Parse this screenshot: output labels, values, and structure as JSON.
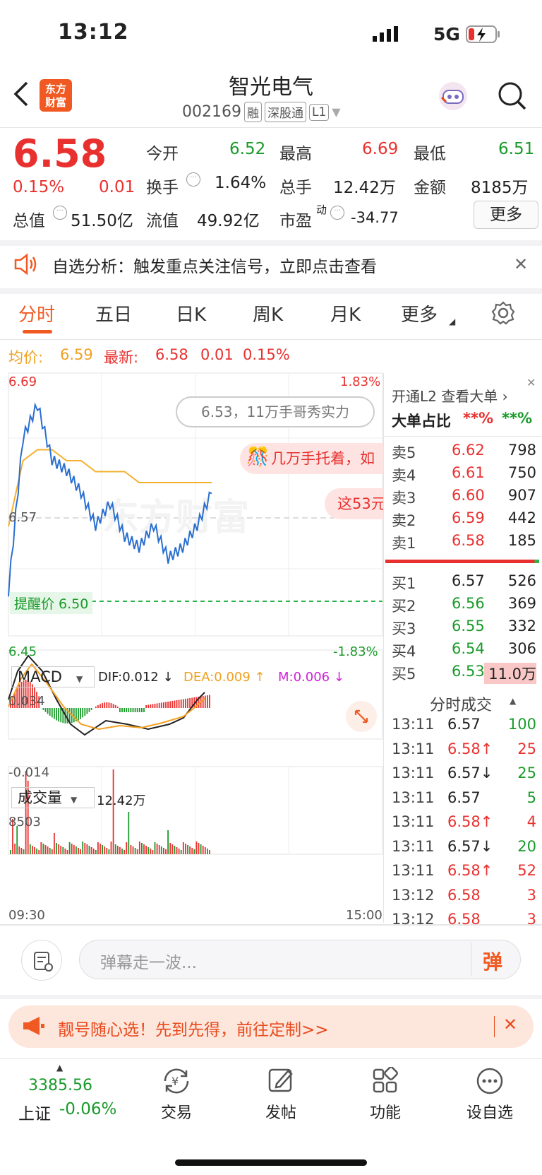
{
  "status": {
    "time": "13:12",
    "network": "5G"
  },
  "header": {
    "title": "智光电气",
    "code": "002169",
    "tags": [
      "融",
      "深股通",
      "L1"
    ],
    "logo": "东方财富"
  },
  "quote": {
    "price": "6.58",
    "pct": "0.15%",
    "chg": "0.01",
    "open_label": "今开",
    "open": "6.52",
    "high_label": "最高",
    "high": "6.69",
    "low_label": "最低",
    "low": "6.51",
    "turnover_label": "换手",
    "turnover": "1.64%",
    "vol_label": "总手",
    "vol": "12.42万",
    "amt_label": "金额",
    "amt": "8185万",
    "mcap_label": "总值",
    "mcap": "51.50亿",
    "float_label": "流值",
    "float": "49.92亿",
    "pe_label": "市盈",
    "pe_sup": "动",
    "pe": "-34.77",
    "more": "更多"
  },
  "notice": "自选分析：触发重点关注信号，立即点击查看",
  "tabs": [
    "分时",
    "五日",
    "日K",
    "周K",
    "月K",
    "更多"
  ],
  "info": {
    "avg_label": "均价:",
    "avg": "6.59",
    "last_label": "最新:",
    "last": "6.58",
    "chg": "0.01",
    "pct": "0.15%"
  },
  "chart": {
    "ymax": "6.69",
    "ymin": "6.45",
    "ymid": "6.57",
    "pmax": "1.83%",
    "pmin": "-1.83%",
    "alert": "提醒价 6.50",
    "watermark": "东方财富",
    "bubble1": "6.53，11万手哥秀实力",
    "bubble2": "几万手托着，如",
    "bubble3": "这53元",
    "macd_label": "MACD",
    "dif": "DIF:0.012 ↓",
    "dea": "DEA:0.009 ↑",
    "m": "M:0.006 ↓",
    "macd_top": "0.034",
    "macd_bot": "-0.014",
    "vol_label": "成交量",
    "vol_total": "12.42万",
    "vol_max": "8503",
    "t_start": "09:30",
    "t_end": "15:00"
  },
  "chart_data": {
    "type": "line",
    "x_range": [
      "09:30",
      "15:00"
    ],
    "ylim": [
      6.45,
      6.69
    ],
    "series": [
      {
        "name": "价格",
        "values": [
          6.49,
          6.63,
          6.66,
          6.61,
          6.6,
          6.58,
          6.55,
          6.57,
          6.54,
          6.53,
          6.55,
          6.52,
          6.53,
          6.55,
          6.58
        ]
      },
      {
        "name": "均价",
        "values": [
          6.55,
          6.61,
          6.62,
          6.62,
          6.61,
          6.61,
          6.6,
          6.6,
          6.6,
          6.59,
          6.59,
          6.59,
          6.59,
          6.59,
          6.59
        ]
      }
    ]
  },
  "l2": {
    "title": "开通L2 查看大单 ›",
    "ratio_label": "大单占比",
    "ratio_red": "**%",
    "ratio_green": "**%"
  },
  "asks": [
    {
      "l": "卖5",
      "p": "6.62",
      "v": "798"
    },
    {
      "l": "卖4",
      "p": "6.61",
      "v": "750"
    },
    {
      "l": "卖3",
      "p": "6.60",
      "v": "907"
    },
    {
      "l": "卖2",
      "p": "6.59",
      "v": "442"
    },
    {
      "l": "卖1",
      "p": "6.58",
      "v": "185"
    }
  ],
  "bids": [
    {
      "l": "买1",
      "p": "6.57",
      "v": "526"
    },
    {
      "l": "买2",
      "p": "6.56",
      "v": "369"
    },
    {
      "l": "买3",
      "p": "6.55",
      "v": "332"
    },
    {
      "l": "买4",
      "p": "6.54",
      "v": "306"
    },
    {
      "l": "买5",
      "p": "6.53",
      "v": "11.0万"
    }
  ],
  "ticks_title": "分时成交",
  "ticks": [
    {
      "t": "13:11",
      "p": "6.57",
      "v": "100"
    },
    {
      "t": "13:11",
      "p": "6.58↑",
      "v": "25"
    },
    {
      "t": "13:11",
      "p": "6.57↓",
      "v": "25"
    },
    {
      "t": "13:11",
      "p": "6.57",
      "v": "5"
    },
    {
      "t": "13:11",
      "p": "6.58↑",
      "v": "4"
    },
    {
      "t": "13:11",
      "p": "6.57↓",
      "v": "20"
    },
    {
      "t": "13:11",
      "p": "6.58↑",
      "v": "52"
    },
    {
      "t": "13:12",
      "p": "6.58",
      "v": "3"
    },
    {
      "t": "13:12",
      "p": "6.58",
      "v": "3"
    }
  ],
  "danmu": {
    "placeholder": "弹幕走一波...",
    "btn": "弹"
  },
  "promo": "靓号随心选！先到先得，前往定制>>",
  "bottom": {
    "index_val": "3385.56",
    "index_name": "上证",
    "index_pct": "-0.06%",
    "trade": "交易",
    "post": "发帖",
    "func": "功能",
    "watch": "设自选"
  }
}
